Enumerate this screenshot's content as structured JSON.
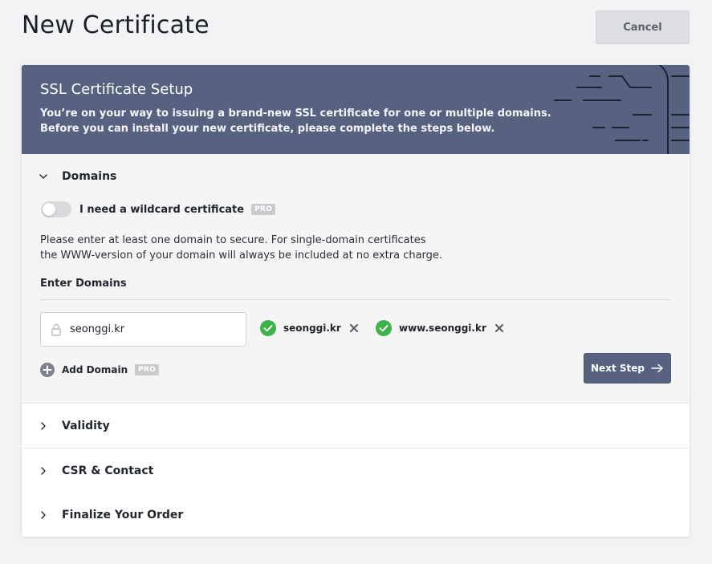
{
  "page": {
    "title": "New Certificate",
    "cancel_label": "Cancel"
  },
  "banner": {
    "title": "SSL Certificate Setup",
    "line1": "You’re on your way to issuing a brand-new SSL certificate for one or multiple domains.",
    "line2": "Before you can install your new certificate, please complete the steps below."
  },
  "domains": {
    "label": "Domains",
    "wildcard_label": "I need a wildcard certificate",
    "wildcard_enabled": false,
    "pro_badge": "PRO",
    "help_line1": "Please enter at least one domain to secure. For single-domain certificates",
    "help_line2": "the WWW-version of your domain will always be included at no extra charge.",
    "enter_label": "Enter Domains",
    "input_value": "seonggi.kr",
    "chips": [
      {
        "label": "seonggi.kr"
      },
      {
        "label": "www.seonggi.kr"
      }
    ],
    "add_domain_label": "Add Domain",
    "next_label": "Next Step"
  },
  "sections": [
    {
      "label": "Validity"
    },
    {
      "label": "CSR & Contact"
    },
    {
      "label": "Finalize Your Order"
    }
  ],
  "colors": {
    "banner": "#56627f",
    "accent": "#56627f",
    "success": "#3cb44a"
  },
  "icons": {
    "expanded_chevron": "chevron-down-icon",
    "collapsed_chevron": "chevron-right-icon",
    "lock": "lock-icon",
    "valid": "check-circle-icon",
    "remove": "close-icon",
    "add": "plus-circle-icon",
    "next": "arrow-right-icon"
  }
}
